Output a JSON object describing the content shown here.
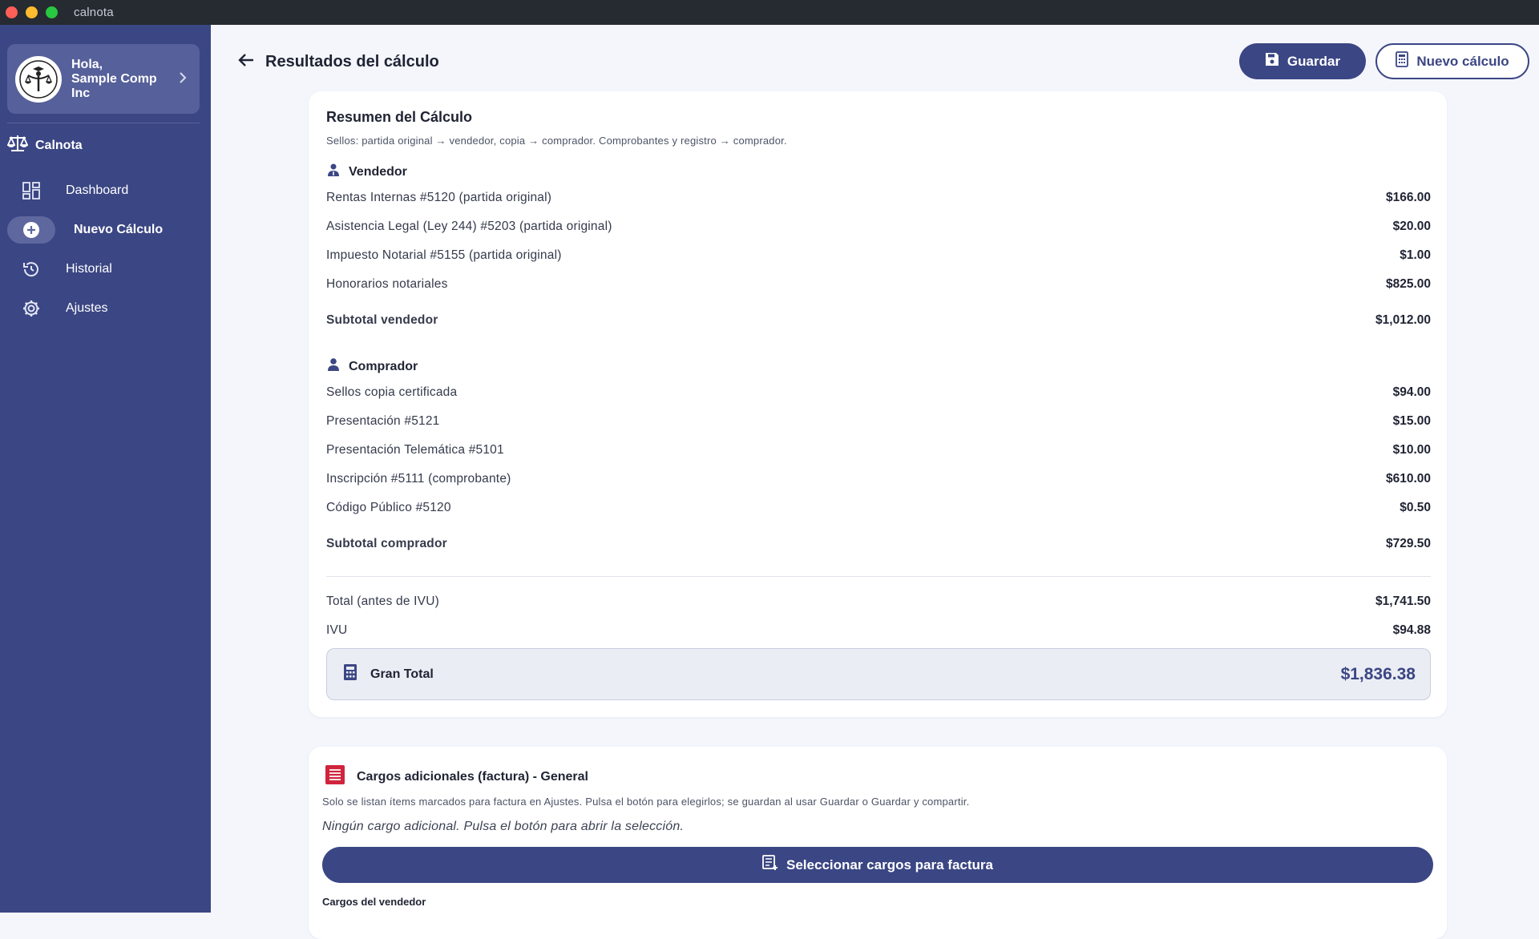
{
  "window": {
    "title": "calnota"
  },
  "sidebar": {
    "greeting": "Hola,",
    "user_name": "Sample Comp Inc",
    "brand": "Calnota",
    "items": [
      {
        "label": "Dashboard",
        "icon": "dashboard-icon",
        "active": false
      },
      {
        "label": "Nuevo Cálculo",
        "icon": "add-circle-icon",
        "active": true
      },
      {
        "label": "Historial",
        "icon": "history-icon",
        "active": false
      },
      {
        "label": "Ajustes",
        "icon": "gear-icon",
        "active": false
      }
    ]
  },
  "header": {
    "title": "Resultados del cálculo",
    "save_label": "Guardar",
    "new_calc_label": "Nuevo cálculo"
  },
  "summary": {
    "title": "Resumen del Cálculo",
    "note": "Sellos: partida original → vendedor, copia → comprador. Comprobantes y registro → comprador.",
    "seller": {
      "heading": "Vendedor",
      "items": [
        {
          "label": "Rentas Internas #5120 (partida original)",
          "amount": "$166.00"
        },
        {
          "label": "Asistencia Legal (Ley 244) #5203 (partida original)",
          "amount": "$20.00"
        },
        {
          "label": "Impuesto Notarial #5155 (partida original)",
          "amount": "$1.00"
        },
        {
          "label": "Honorarios notariales",
          "amount": "$825.00"
        }
      ],
      "subtotal_label": "Subtotal vendedor",
      "subtotal": "$1,012.00"
    },
    "buyer": {
      "heading": "Comprador",
      "items": [
        {
          "label": "Sellos copia certificada",
          "amount": "$94.00"
        },
        {
          "label": "Presentación #5121",
          "amount": "$15.00"
        },
        {
          "label": "Presentación Telemática #5101",
          "amount": "$10.00"
        },
        {
          "label": "Inscripción #5111 (comprobante)",
          "amount": "$610.00"
        },
        {
          "label": "Código Público #5120",
          "amount": "$0.50"
        }
      ],
      "subtotal_label": "Subtotal comprador",
      "subtotal": "$729.50"
    },
    "total_label": "Total (antes de IVU)",
    "total": "$1,741.50",
    "ivu_label": "IVU",
    "ivu": "$94.88",
    "grand_total_label": "Gran Total",
    "grand_total": "$1,836.38"
  },
  "extras": {
    "title": "Cargos adicionales (factura) - General",
    "note": "Solo se listan ítems marcados para factura en Ajustes. Pulsa el botón para elegirlos; se guardan al usar Guardar o Guardar y compartir.",
    "empty_text": "Ningún cargo adicional. Pulsa el botón para abrir la selección.",
    "select_button": "Seleccionar cargos para factura",
    "seller_charges_label": "Cargos del vendedor"
  },
  "colors": {
    "primary": "#3b4684",
    "sidebar_bg": "#3b4684",
    "background": "#f4f6fc",
    "receipt_icon": "#d0243c"
  }
}
